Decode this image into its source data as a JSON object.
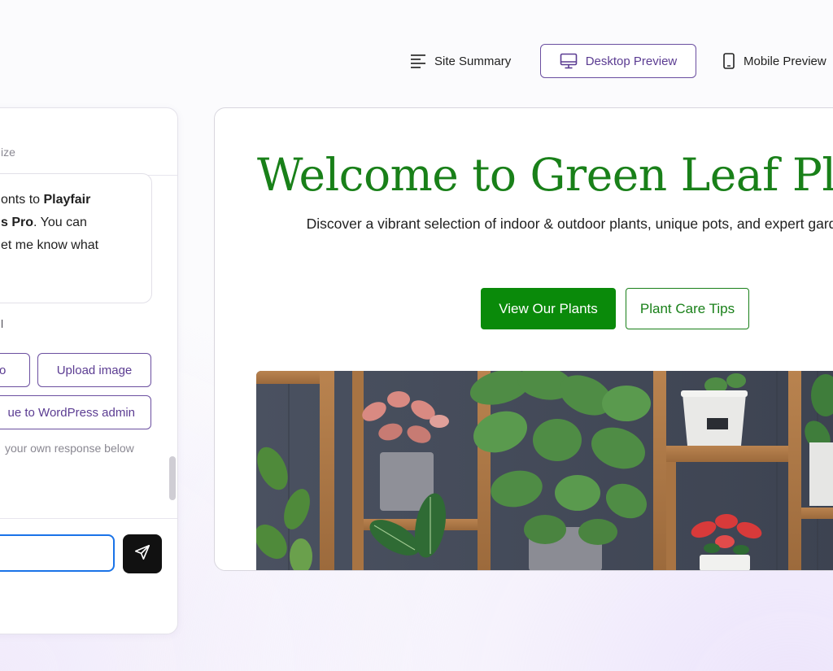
{
  "toolbar": {
    "site_summary_label": "Site Summary",
    "desktop_preview_label": "Desktop Preview",
    "mobile_preview_label": "Mobile Preview",
    "active_tab": "Desktop Preview"
  },
  "chat": {
    "header_partial": "ize",
    "message_lines": [
      {
        "pre": "onts to ",
        "bold": "Playfair",
        "post": ""
      },
      {
        "pre": "",
        "bold": "s Pro",
        "post": ". You can"
      },
      {
        "pre": "et me know what",
        "bold": "",
        "post": ""
      }
    ],
    "options_label_partial": "l",
    "buttons": {
      "logo_partial": "go",
      "upload_image": "Upload image",
      "continue_wp": "ue to WordPress admin"
    },
    "hint_partial": "your own response below",
    "input_value": "",
    "input_placeholder": ""
  },
  "site": {
    "hero_title": "Welcome to Green Leaf Plan",
    "hero_description": "Discover a vibrant selection of indoor & outdoor plants, unique pots, and expert garde plant lovers.",
    "cta_primary": "View Our Plants",
    "cta_secondary": "Plant Care Tips"
  },
  "colors": {
    "brand_green": "#198019",
    "button_green": "#0a8a0a",
    "accent_purple": "#5b3c92",
    "input_focus_blue": "#1a73e8"
  },
  "icons": {
    "site_summary": "lines-icon",
    "desktop_preview": "monitor-icon",
    "mobile_preview": "phone-icon",
    "send": "send-icon"
  }
}
